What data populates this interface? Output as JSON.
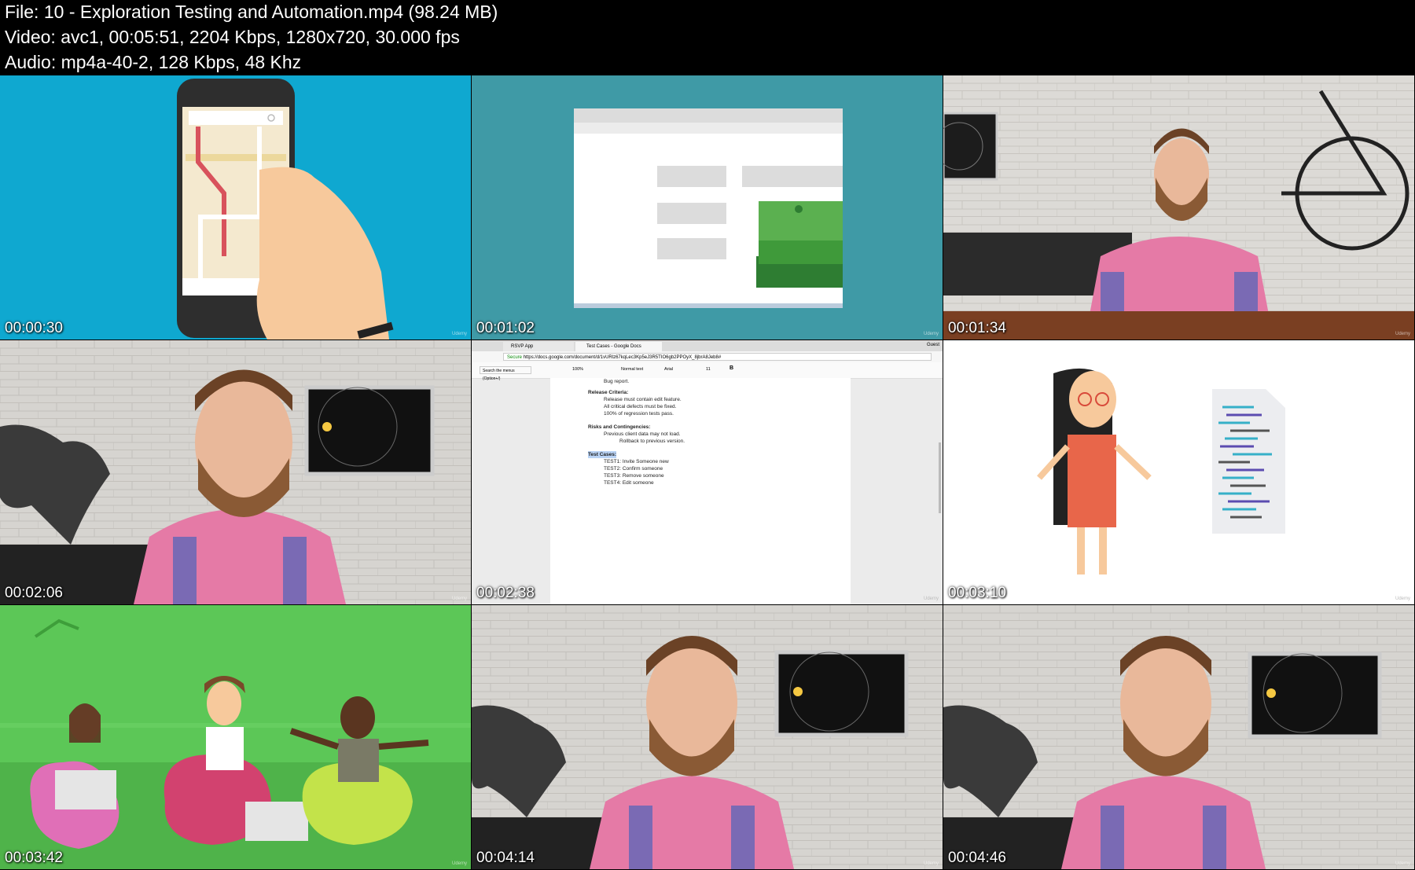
{
  "header": {
    "file_line": "File: 10 - Exploration Testing and Automation.mp4 (98.24 MB)",
    "video_line": "Video: avc1, 00:05:51, 2204 Kbps, 1280x720, 30.000 fps",
    "audio_line": "Audio: mp4a-40-2, 128 Kbps, 48 Khz"
  },
  "thumbnails": [
    {
      "timestamp": "00:00:30",
      "scene": "hand-holding-phone-map-illustration"
    },
    {
      "timestamp": "00:01:02",
      "scene": "browser-window-with-money-illustration"
    },
    {
      "timestamp": "00:01:34",
      "scene": "presenter-at-desk-with-bicycle"
    },
    {
      "timestamp": "00:02:06",
      "scene": "presenter-closeup-map-wall"
    },
    {
      "timestamp": "00:02:38",
      "scene": "google-docs-test-plan"
    },
    {
      "timestamp": "00:03:10",
      "scene": "character-with-document-illustration"
    },
    {
      "timestamp": "00:03:42",
      "scene": "three-people-beanbags-illustration"
    },
    {
      "timestamp": "00:04:14",
      "scene": "presenter-closeup-map-wall"
    },
    {
      "timestamp": "00:04:46",
      "scene": "presenter-closeup-map-wall"
    }
  ],
  "watermark": "Udemy",
  "doc": {
    "tab1": "RSVP App",
    "tab2": "Test Cases - Google Docs",
    "url_secure": "Secure",
    "url": "https://docs.google.com/document/d/1vURlz67kqLec3Kp5eJ3R5TIO6gb2PPOyX_8jbrA8Jeb8#",
    "guest": "Guest",
    "menu_search": "Search the menus (Option+/)",
    "zoom": "100%",
    "style": "Normal text",
    "font": "Arial",
    "size": "11",
    "bug_report": "Bug report.",
    "release_heading": "Release Criteria:",
    "release_items": [
      "Release must contain edit feature.",
      "All critical defects must be fixed.",
      "100% of regression tests pass."
    ],
    "risks_heading": "Risks and Contingencies:",
    "risks_item": "Previous client data may not load.",
    "risks_subitem": "Rollback to previous version.",
    "tests_heading": "Test Cases:",
    "test_items": [
      "TEST1: Invite Someone new",
      "TEST2: Confirm someone",
      "TEST3: Remove someone",
      "TEST4: Edit someone"
    ]
  },
  "colors": {
    "teal_bg": "#0fa8d0",
    "teal2_bg": "#3f9aa6",
    "green_bg": "#5cc757",
    "shirt_pink": "#e57aa6",
    "money_green": "#3f9a3a"
  }
}
